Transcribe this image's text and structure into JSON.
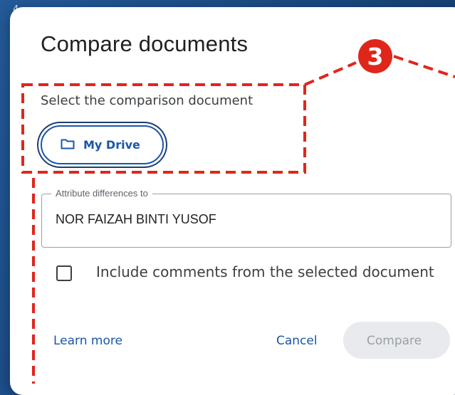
{
  "background_char": "4",
  "dialog": {
    "title": "Compare documents",
    "subtitle": "Select the comparison document",
    "drive_button_label": "My Drive",
    "attribute_field": {
      "label": "Attribute differences to",
      "value": "NOR FAIZAH BINTI YUSOF"
    },
    "include_comments": {
      "label": "Include comments from the selected document",
      "checked": false
    },
    "learn_more_label": "Learn more",
    "cancel_label": "Cancel",
    "compare_label": "Compare"
  },
  "annotation": {
    "step_number": "3",
    "color": "#e0261b"
  },
  "colors": {
    "accent": "#1a56a8",
    "disabled_button_bg": "#e8eaed",
    "disabled_button_text": "#9aa0a6"
  }
}
